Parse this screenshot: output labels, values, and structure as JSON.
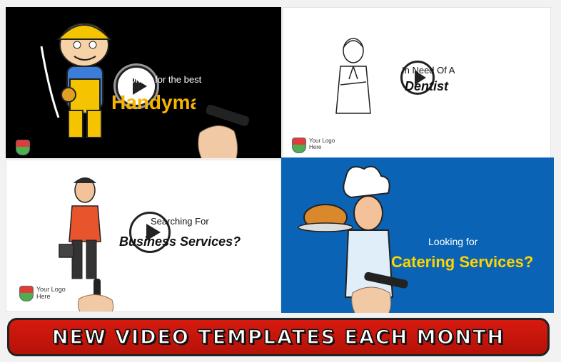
{
  "tiles": [
    {
      "line1": "Looking for the best",
      "line2": "Handyman",
      "line2_color": "#f5b400"
    },
    {
      "line1": "In Need Of A",
      "line2": "Dentist",
      "logo_text": "Your Logo\nHere"
    },
    {
      "line1": "Searching For",
      "line2": "Business Services?",
      "logo_text": "Your Logo\nHere"
    },
    {
      "line1": "Looking for",
      "line2": "Catering Services?",
      "line2_color": "#ffd400",
      "bg": "#0a63b5"
    }
  ],
  "banner": {
    "text": "NEW VIDEO TEMPLATES EACH MONTH",
    "color": "#d71a0f"
  }
}
